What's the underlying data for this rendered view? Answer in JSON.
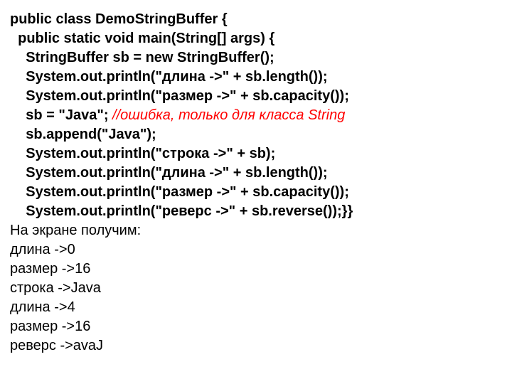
{
  "code": {
    "l1": "public class DemoStringBuffer {",
    "l2": "  public static void main(String[] args) {",
    "l3": "    StringBuffer sb = new StringBuffer();",
    "l4": "    System.out.println(\"длина ->\" + sb.length());",
    "l5": "    System.out.println(\"размер ->\" + sb.capacity());",
    "l6a": "    sb = \"Java\"; ",
    "l6b": "//ошибка, только для класса String",
    "l7": "    sb.append(\"Java\");",
    "l8": "    System.out.println(\"строка ->\" + sb);",
    "l9": "    System.out.println(\"длина ->\" + sb.length());",
    "l10": "    System.out.println(\"размер ->\" + sb.capacity());",
    "l11": "    System.out.println(\"реверс ->\" + sb.reverse());}}"
  },
  "output": {
    "o0": "На экране получим:",
    "o1": "длина ->0",
    "o2": "размер ->16",
    "o3": "строка ->Java",
    "o4": "длина ->4",
    "o5": "размер ->16",
    "o6": "реверс ->avaJ"
  }
}
